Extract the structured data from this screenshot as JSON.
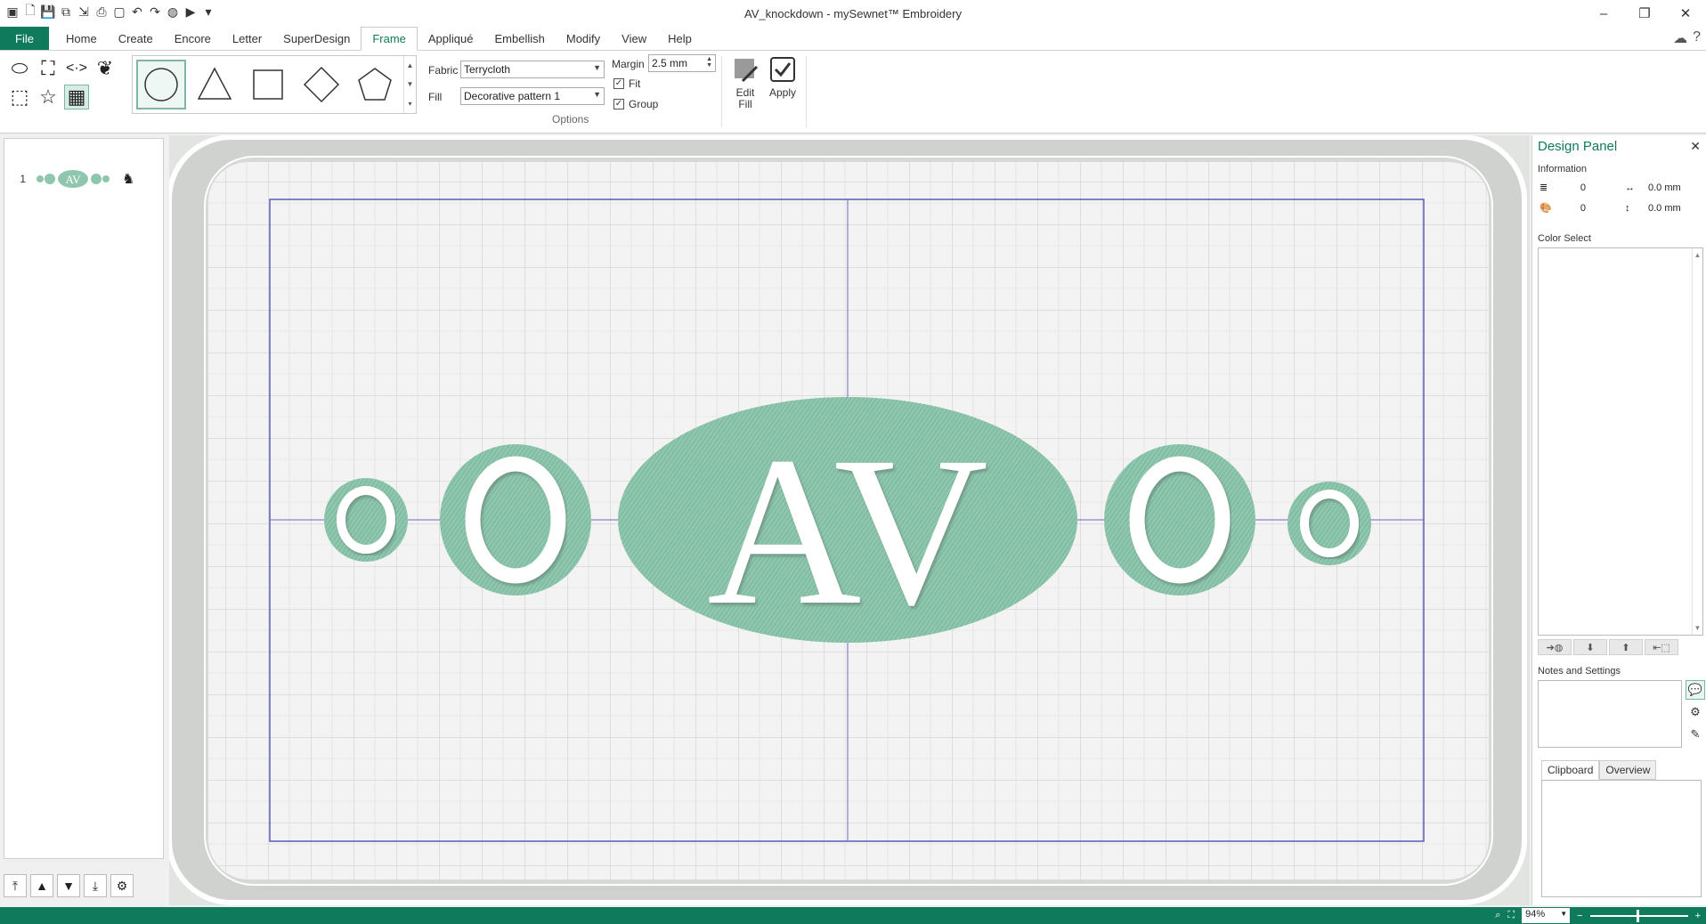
{
  "window": {
    "title": "AV_knockdown - mySewnet™ Embroidery",
    "controls": [
      "–",
      "❐",
      "✕"
    ]
  },
  "menu": {
    "file_label": "File",
    "tabs": [
      "Home",
      "Create",
      "Encore",
      "Letter",
      "SuperDesign",
      "Frame",
      "Appliqué",
      "Embellish",
      "Modify",
      "View",
      "Help"
    ],
    "active_tab": "Frame"
  },
  "ribbon": {
    "fabric_label": "Fabric",
    "fabric_value": "Terrycloth",
    "fill_label": "Fill",
    "fill_value": "Decorative pattern 1",
    "margin_label": "Margin",
    "margin_value": "2.5 mm",
    "fit_label": "Fit",
    "group_label": "Group",
    "fit_checked": true,
    "group_checked": true,
    "options_label": "Options",
    "edit_fill_label_1": "Edit",
    "edit_fill_label_2": "Fill",
    "apply_label": "Apply",
    "frame_shapes": [
      "circle",
      "triangle",
      "square",
      "diamond",
      "pentagon"
    ]
  },
  "layers": {
    "items": [
      {
        "number": "1"
      }
    ]
  },
  "design": {
    "text": "AV",
    "accent_color": "#8fc7ae",
    "letter_color": "#ffffff"
  },
  "design_panel": {
    "title": "Design Panel",
    "information_label": "Information",
    "stitches": "0",
    "colors": "0",
    "width": "0.0 mm",
    "height": "0.0 mm",
    "color_select_label": "Color Select",
    "notes_label": "Notes and Settings",
    "clipboard_tab": "Clipboard",
    "overview_tab": "Overview"
  },
  "status": {
    "zoom_value": "94%"
  },
  "colors": {
    "brand": "#0f7a5c",
    "embroidery": "#8fc7ae"
  }
}
